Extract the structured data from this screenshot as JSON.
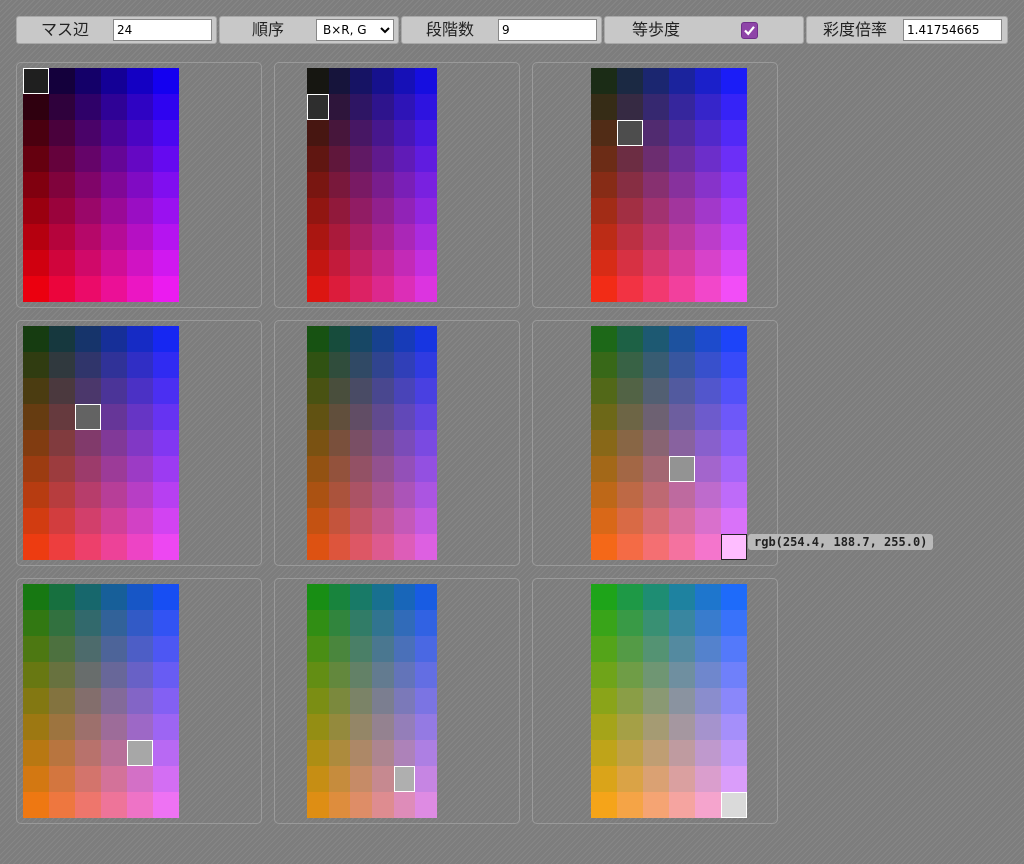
{
  "toolbar": {
    "cell_size": {
      "label": "マス辺",
      "value": "24"
    },
    "order": {
      "label": "順序",
      "selected": "B×R, G"
    },
    "steps": {
      "label": "段階数",
      "value": "9"
    },
    "equal_step": {
      "label": "等歩度",
      "checked": true
    },
    "saturation": {
      "label": "彩度倍率",
      "value": "1.41754665"
    }
  },
  "palette": {
    "grid_cols": 6,
    "grid_rows": 9,
    "panel_rows": 3,
    "panel_cols": 3,
    "selected_cells": [
      {
        "panel": 0,
        "col": 0,
        "row": 0
      },
      {
        "panel": 1,
        "col": 0,
        "row": 1
      },
      {
        "panel": 2,
        "col": 1,
        "row": 2
      },
      {
        "panel": 3,
        "col": 2,
        "row": 3
      },
      {
        "panel": 5,
        "col": 3,
        "row": 5
      },
      {
        "panel": 6,
        "col": 4,
        "row": 6
      },
      {
        "panel": 7,
        "col": 4,
        "row": 7
      },
      {
        "panel": 8,
        "col": 5,
        "row": 8
      }
    ],
    "hover_cell": {
      "panel": 5,
      "col": 5,
      "row": 8
    }
  },
  "tooltip": {
    "text": "rgb(254.4, 188.7, 255.0)"
  }
}
